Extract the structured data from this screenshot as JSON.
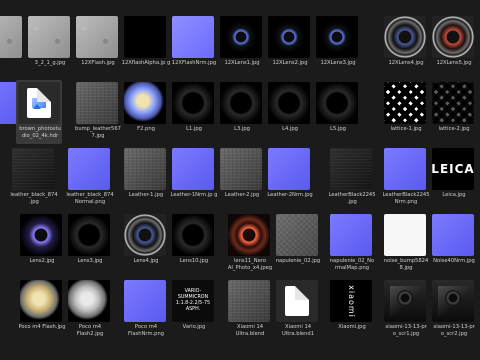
{
  "tiles": [
    {
      "label": "",
      "thumb": "noise"
    },
    {
      "label": "3_2_1_g.jpg",
      "thumb": "noise"
    },
    {
      "label": "12XFlash.jpg",
      "thumb": "noise"
    },
    {
      "label": "12XflashAlpha.jp g",
      "thumb": "black"
    },
    {
      "label": "12XFlashNrm.jpg",
      "thumb": "normal2"
    },
    {
      "label": "12XLens1.jpg",
      "thumb": "lens-small"
    },
    {
      "label": "12XLens2.jpg",
      "thumb": "lens-small"
    },
    {
      "label": "12XLens3.jpg",
      "thumb": "lens-small"
    },
    {
      "label": "12XLens4.jpg",
      "thumb": "lens-big"
    },
    {
      "label": "12XLens5.jpg",
      "thumb": "lens-red"
    },
    {
      "label": "",
      "thumb": "normal"
    },
    {
      "label": "brown_photostu dio_02_4k.hdr",
      "thumb": "file"
    },
    {
      "label": "bump_leather567 7.jpg",
      "thumb": "leather"
    },
    {
      "label": "F2.png",
      "thumb": "bluegold"
    },
    {
      "label": "L1.jpg",
      "thumb": "lens-dark"
    },
    {
      "label": "L3.jpg",
      "thumb": "lens-dark"
    },
    {
      "label": "L4.jpg",
      "thumb": "lens-dark"
    },
    {
      "label": "L5.jpg",
      "thumb": "lens-dark"
    },
    {
      "label": "lattice-1.jpg",
      "thumb": "lattice"
    },
    {
      "label": "lattice-2.jpg",
      "thumb": "lattice2"
    },
    {
      "label": "leather_black_874 .jpg",
      "thumb": "leather-dark"
    },
    {
      "label": "leather_black_874 Normal.png",
      "thumb": "normal"
    },
    {
      "label": "Leather-1.jpg",
      "thumb": "leather"
    },
    {
      "label": "Leather-1Nrm.jp g",
      "thumb": "normal"
    },
    {
      "label": "Leather-2.jpg",
      "thumb": "leather"
    },
    {
      "label": "Leather-2Nrm.jpg",
      "thumb": "normal"
    },
    {
      "label": "LeatherBlack2245 .jpg",
      "thumb": "leather-dark"
    },
    {
      "label": "LeatherBlack2245 Nrm.png",
      "thumb": "normal"
    },
    {
      "label": "Leica.jpg",
      "thumb": "leica",
      "text": "LEICA"
    },
    {
      "label": "Lens2.jpg",
      "thumb": "lens-purple"
    },
    {
      "label": "Lens3.jpg",
      "thumb": "lens-dark"
    },
    {
      "label": "Lens4.jpg",
      "thumb": "lens-big"
    },
    {
      "label": "Lens10.jpg",
      "thumb": "lens-dark"
    },
    {
      "label": "lens11_Nero AI_Photo_x4.jpeg",
      "thumb": "lens-orange"
    },
    {
      "label": "napulenie_02.jpg",
      "thumb": "fabric"
    },
    {
      "label": "napulenie_02_No rmalMap.png",
      "thumb": "normal"
    },
    {
      "label": "noise_bump5824 8.jpg",
      "thumb": "white"
    },
    {
      "label": "Noise40Nrm.jpg",
      "thumb": "normal"
    },
    {
      "label": "Poco m4 Flash.jpg",
      "thumb": "gold"
    },
    {
      "label": "Poco m4 Flash2.jpg",
      "thumb": "silver"
    },
    {
      "label": "Poco m4 FlashNrm.png",
      "thumb": "normal"
    },
    {
      "label": "Vario.jpg",
      "thumb": "vario",
      "text": "VARIO-SUMMICRON 1:1.8-2.2/5-75 ASPH."
    },
    {
      "label": "Xiaomi 14 Ultra.blend",
      "thumb": "leather"
    },
    {
      "label": "Xiaomi 14 Ultra.blend1",
      "thumb": "file-plain"
    },
    {
      "label": "Xiaomi.jpg",
      "thumb": "xiaomi",
      "text": "xiaomi"
    },
    {
      "label": "xiaomi-13-13-pr o_scr1.jpg",
      "thumb": "phone"
    },
    {
      "label": "xiaomi-13-13-pr o_scr2.jpg",
      "thumb": "phone"
    }
  ]
}
